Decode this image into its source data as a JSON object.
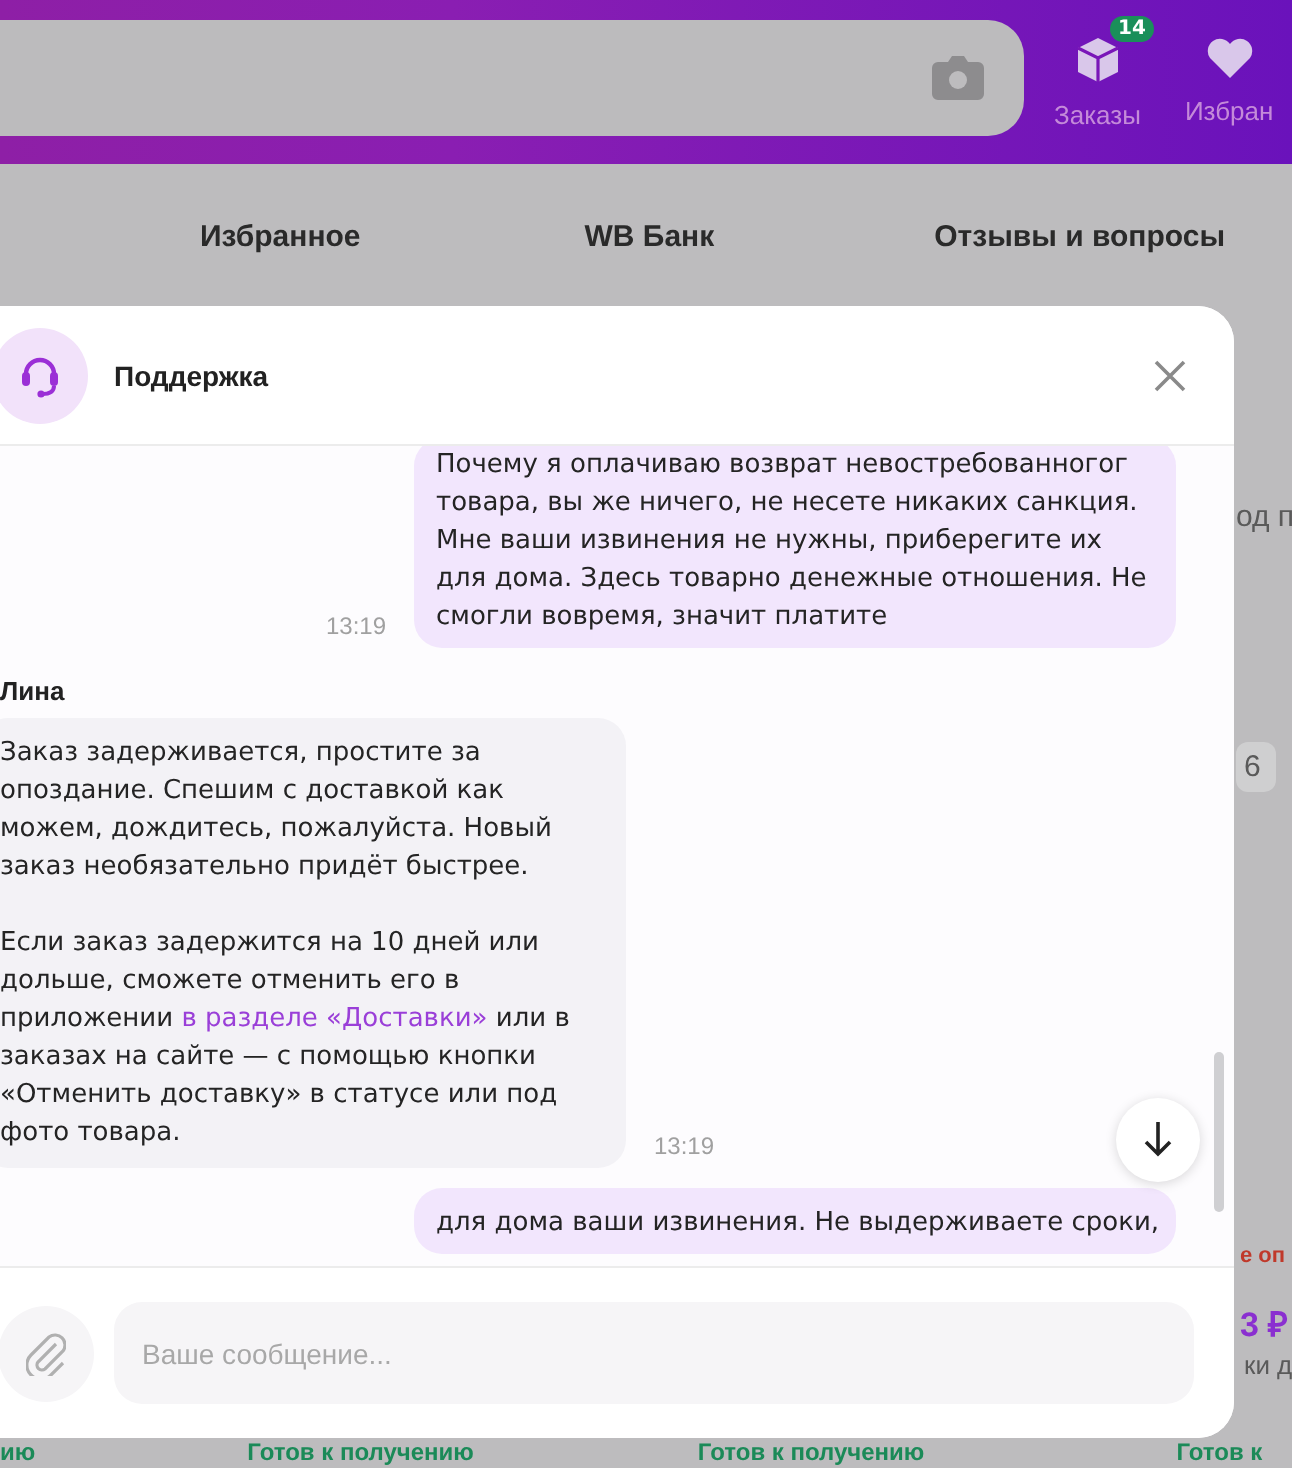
{
  "header": {
    "nav_icons": [
      {
        "kind": "box",
        "label": "Заказы",
        "badge": "14"
      },
      {
        "kind": "heart",
        "label": "Избран"
      }
    ]
  },
  "nav": {
    "items": [
      "Избранное",
      "WB Банк",
      "Отзывы и вопросы"
    ]
  },
  "background_fragments": {
    "right_column": [
      {
        "kind": "plain",
        "text": "од п"
      },
      {
        "kind": "chip",
        "text": "6"
      },
      {
        "kind": "alert",
        "text": "е оп"
      },
      {
        "kind": "price",
        "text": "3 ₽"
      },
      {
        "kind": "plain",
        "text": "ки д"
      }
    ],
    "status_row": [
      "ию",
      "Готов к получению",
      "Готов к получению",
      "Готов к"
    ]
  },
  "chat": {
    "title": "Поддержка",
    "messages": [
      {
        "kind": "outgoing",
        "paragraphs": [
          [
            {
              "text": "Почему я оплачиваю возврат невостребованногог товара, вы же ничего, не несете никаких санкция. Мне ваши извинения не нужны, приберегите их для дома. Здесь товарно денежные отношения. Не смогли вовремя, значит платите"
            }
          ]
        ],
        "time": "13:19"
      },
      {
        "kind": "incoming",
        "author": "Лина",
        "paragraphs": [
          [
            {
              "text": "Заказ задерживается, простите за опоздание. Спешим с доставкой как можем, дождитесь, пожалуйста. Новый заказ необязательно придёт быстрее."
            }
          ],
          [
            {
              "text": "Если заказ задержится на 10 дней или дольше, сможете отменить его в приложении "
            },
            {
              "kind": "link",
              "text": "в разделе «Доставки»"
            },
            {
              "text": " или в заказах на сайте — с помощью кнопки «Отменить доставку» в статусе или под фото товара."
            }
          ]
        ],
        "time": "13:19"
      },
      {
        "kind": "outgoing",
        "paragraphs": [
          [
            {
              "text": "для дома ваши извинения. Не выдерживаете сроки,"
            }
          ]
        ]
      }
    ],
    "input": {
      "placeholder": "Ваше сообщение..."
    }
  }
}
